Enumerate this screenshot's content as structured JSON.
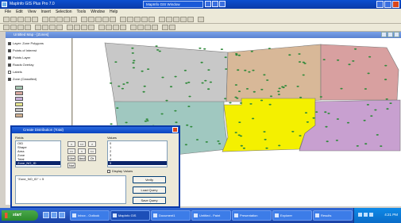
{
  "app": {
    "title": "MapInfo GIS Plus Pro 7.0",
    "chip_title": "MapInfo GIS Window",
    "map_window_title": "Untitled Map - [Zones]"
  },
  "menubar": [
    "File",
    "Edit",
    "View",
    "Insert",
    "Selection",
    "Tools",
    "Window",
    "Help"
  ],
  "toc": {
    "items": [
      {
        "label": "Layer: Zone Polygons",
        "checked": true
      },
      {
        "label": "Points of Interest",
        "checked": true
      },
      {
        "label": "Points Layer",
        "checked": true
      },
      {
        "label": "Roads Overlay",
        "checked": true
      },
      {
        "label": "Labels",
        "checked": false
      },
      {
        "label": "Zone (Classified)",
        "checked": true
      }
    ],
    "legend_colors": [
      "#a8c8b4",
      "#d8a8a0",
      "#c8b0d8",
      "#e8e890",
      "#c0c0c0",
      "#d0b090"
    ]
  },
  "dialog": {
    "title": "Create Distribution (Total)",
    "fields_label": "Fields",
    "values_label": "Values",
    "fields": [
      "OID",
      "Shape",
      "Area",
      "Zone",
      "Total",
      "Zone_NO_ID"
    ],
    "selected_field": 5,
    "values": [
      "0",
      "1",
      "2",
      "3",
      "4",
      "5"
    ],
    "selected_value": 5,
    "operators": [
      "=",
      "<>",
      ">",
      ">=",
      "<",
      "<=",
      "Like",
      "And",
      "Or",
      "Not"
    ],
    "checkbox_label": "Display Values",
    "expression": "\"Zone_NO_ID\" = 5",
    "buttons": [
      "Verify",
      "Load Query",
      "Save Query"
    ]
  },
  "taskbar": {
    "start_label": "start",
    "tasks": [
      "Inbox - Outlook",
      "MapInfo GIS",
      "Document1",
      "Untitled - Paint",
      "Presentation",
      "Explorer",
      "Results"
    ],
    "time": "4:21 PM"
  }
}
